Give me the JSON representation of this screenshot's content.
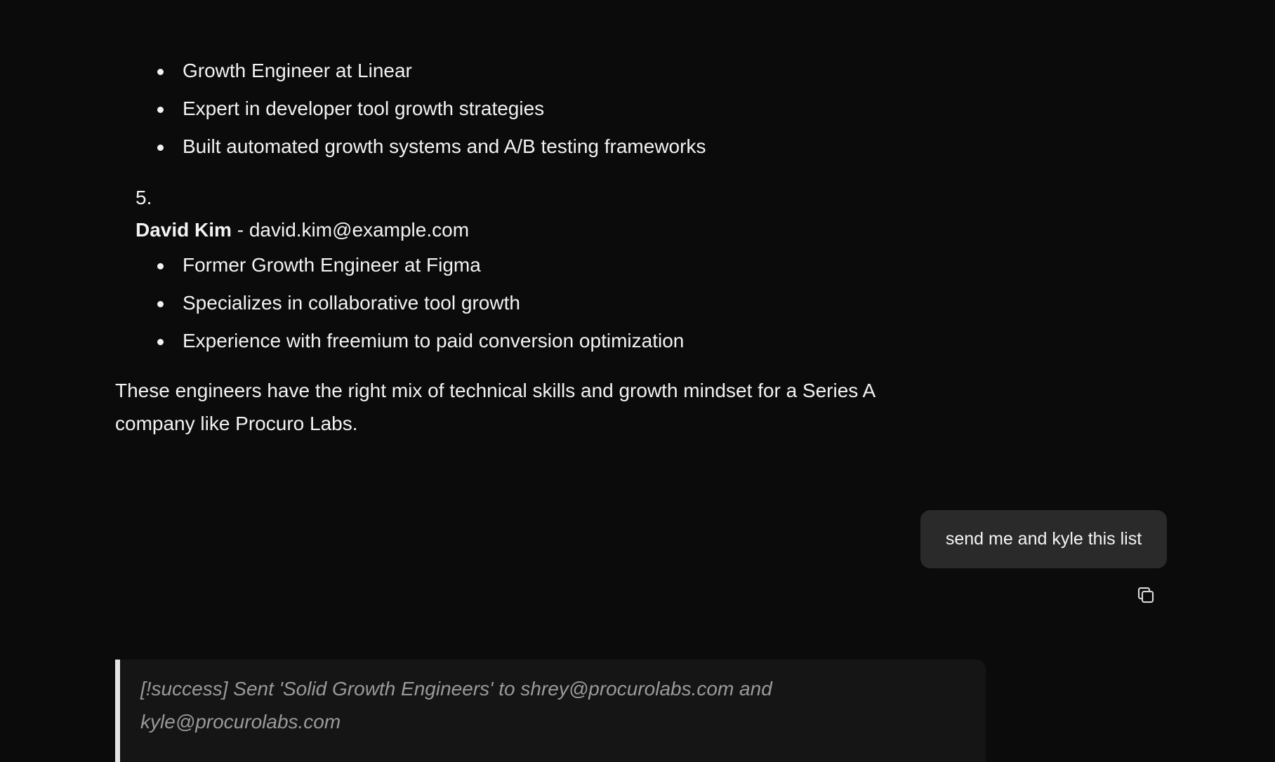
{
  "assistant": {
    "bullets_4": [
      "Growth Engineer at Linear",
      "Expert in developer tool growth strategies",
      "Built automated growth systems and A/B testing frameworks"
    ],
    "item_5": {
      "number": "5.",
      "name": "David Kim",
      "separator": " - ",
      "email": "david.kim@example.com",
      "bullets": [
        "Former Growth Engineer at Figma",
        "Specializes in collaborative tool growth",
        "Experience with freemium to paid conversion optimization"
      ]
    },
    "summary": "These engineers have the right mix of technical skills and growth mindset for a Series A company like Procuro Labs."
  },
  "user_message": {
    "text": "send me and kyle this list",
    "copy_icon": "copy-icon"
  },
  "status": {
    "text": "[!success] Sent 'Solid Growth Engineers' to shrey@procurolabs.com and kyle@procurolabs.com"
  },
  "colors": {
    "background": "#0b0b0b",
    "text": "#f2f2f2",
    "user_bubble": "#2a2a2a",
    "callout_bg": "#151515",
    "callout_border": "#e4e4e4",
    "callout_text": "#9a9a9a"
  }
}
